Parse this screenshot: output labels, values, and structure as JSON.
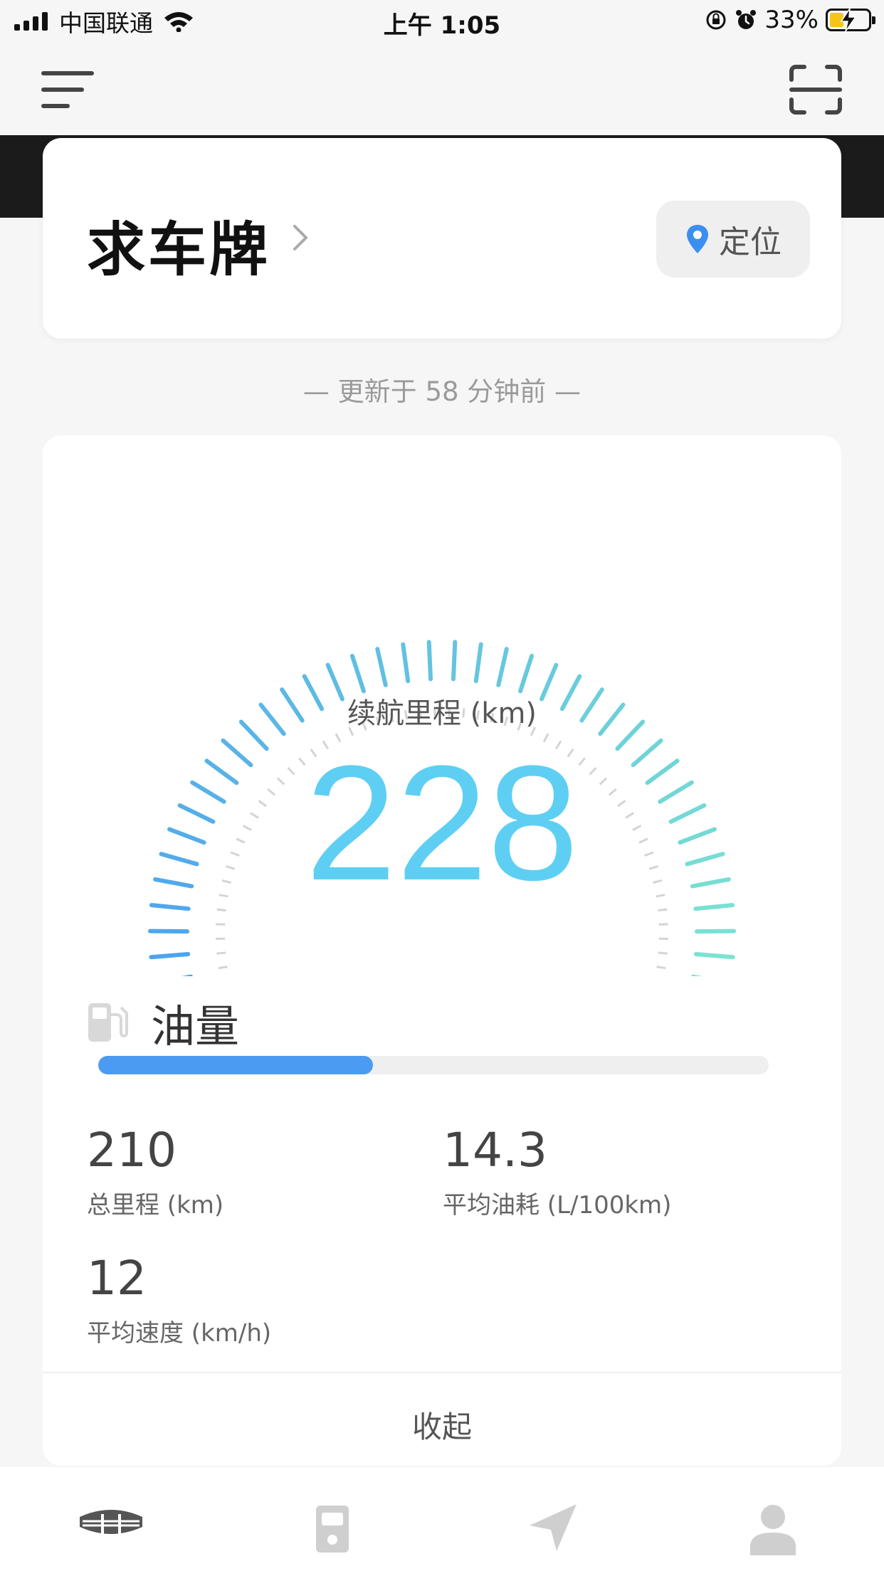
{
  "status_bar": {
    "carrier": "中国联通",
    "time": "上午 1:05",
    "battery_percent": "33%"
  },
  "vehicle": {
    "plate": "求车牌",
    "locate_label": "定位"
  },
  "updated_text": "— 更新于 58 分钟前 —",
  "gauge": {
    "label": "续航里程 (km)",
    "value": "228"
  },
  "fuel": {
    "title": "油量",
    "level_fraction": 0.41
  },
  "stats": [
    {
      "value": "210",
      "label": "总里程 (km)"
    },
    {
      "value": "14.3",
      "label": "平均油耗 (L/100km)"
    },
    {
      "value": "12",
      "label": "平均速度 (km/h)"
    }
  ],
  "collapse_label": "收起",
  "tabs": [
    {
      "icon": "car-logo-icon"
    },
    {
      "icon": "fuel-station-icon"
    },
    {
      "icon": "navigation-icon"
    },
    {
      "icon": "profile-icon"
    }
  ],
  "colors": {
    "gauge_value": "#5ecff3",
    "fuel_fill": "#4b9bf2",
    "gauge_start": "#4a9ff0",
    "gauge_end": "#7ee8d0"
  }
}
